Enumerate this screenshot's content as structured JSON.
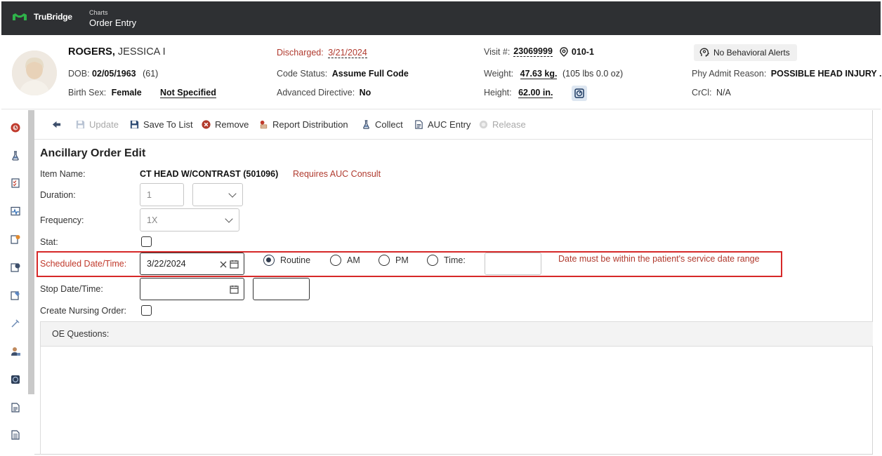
{
  "app": {
    "brand": "TruBridge",
    "breadcrumb_parent": "Charts",
    "breadcrumb_title": "Order Entry"
  },
  "patient": {
    "last_name": "ROGERS,",
    "first_name": "JESSICA I",
    "dob_label": "DOB:",
    "dob": "02/05/1963",
    "age": "(61)",
    "birth_sex_label": "Birth Sex:",
    "birth_sex": "Female",
    "gender_identity": "Not Specified",
    "discharged_label": "Discharged:",
    "discharged_date": "3/21/2024",
    "code_status_label": "Code Status:",
    "code_status": "Assume Full Code",
    "advanced_directive_label": "Advanced Directive:",
    "advanced_directive": "No",
    "visit_label": "Visit #:",
    "visit_number": "23069999",
    "room": "010-1",
    "weight_label": "Weight:",
    "weight": "47.63 kg.",
    "weight_lbs": "(105 lbs 0.0 oz)",
    "height_label": "Height:",
    "height": "62.00 in.",
    "behavioral_alerts": "No Behavioral Alerts",
    "phy_admit_reason_label": "Phy Admit Reason:",
    "phy_admit_reason": "POSSIBLE HEAD INJURY ...",
    "crcl_label": "CrCl:",
    "crcl": "N/A"
  },
  "toolbar": {
    "update": "Update",
    "save_to_list": "Save To List",
    "remove": "Remove",
    "report_distribution": "Report Distribution",
    "collect": "Collect",
    "auc_entry": "AUC Entry",
    "release": "Release"
  },
  "form": {
    "title": "Ancillary Order Edit",
    "item_name_label": "Item Name:",
    "item_name": "CT HEAD W/CONTRAST (501096)",
    "auc_note": "Requires AUC Consult",
    "duration_label": "Duration:",
    "duration_value": "1",
    "frequency_label": "Frequency:",
    "frequency_value": "1X",
    "stat_label": "Stat:",
    "scheduled_label": "Scheduled Date/Time:",
    "scheduled_date": "3/22/2024",
    "routine_label": "Routine",
    "am_label": "AM",
    "pm_label": "PM",
    "time_label": "Time:",
    "date_error": "Date must be within the patient's service date range",
    "stop_label": "Stop Date/Time:",
    "nursing_label": "Create Nursing Order:",
    "oe_questions_label": "OE Questions:"
  },
  "colors": {
    "topbar": "#2e3033",
    "brand_green": "#2fb34a",
    "error_red": "#d62828",
    "note_red": "#b03a2e"
  },
  "icons": {
    "back": "arrow-left-icon",
    "update": "floppy-disk-icon",
    "save": "floppy-disk-icon",
    "remove": "remove-circle-icon",
    "report": "report-distribution-icon",
    "collect": "flask-icon",
    "auc": "document-icon",
    "release": "release-icon"
  }
}
